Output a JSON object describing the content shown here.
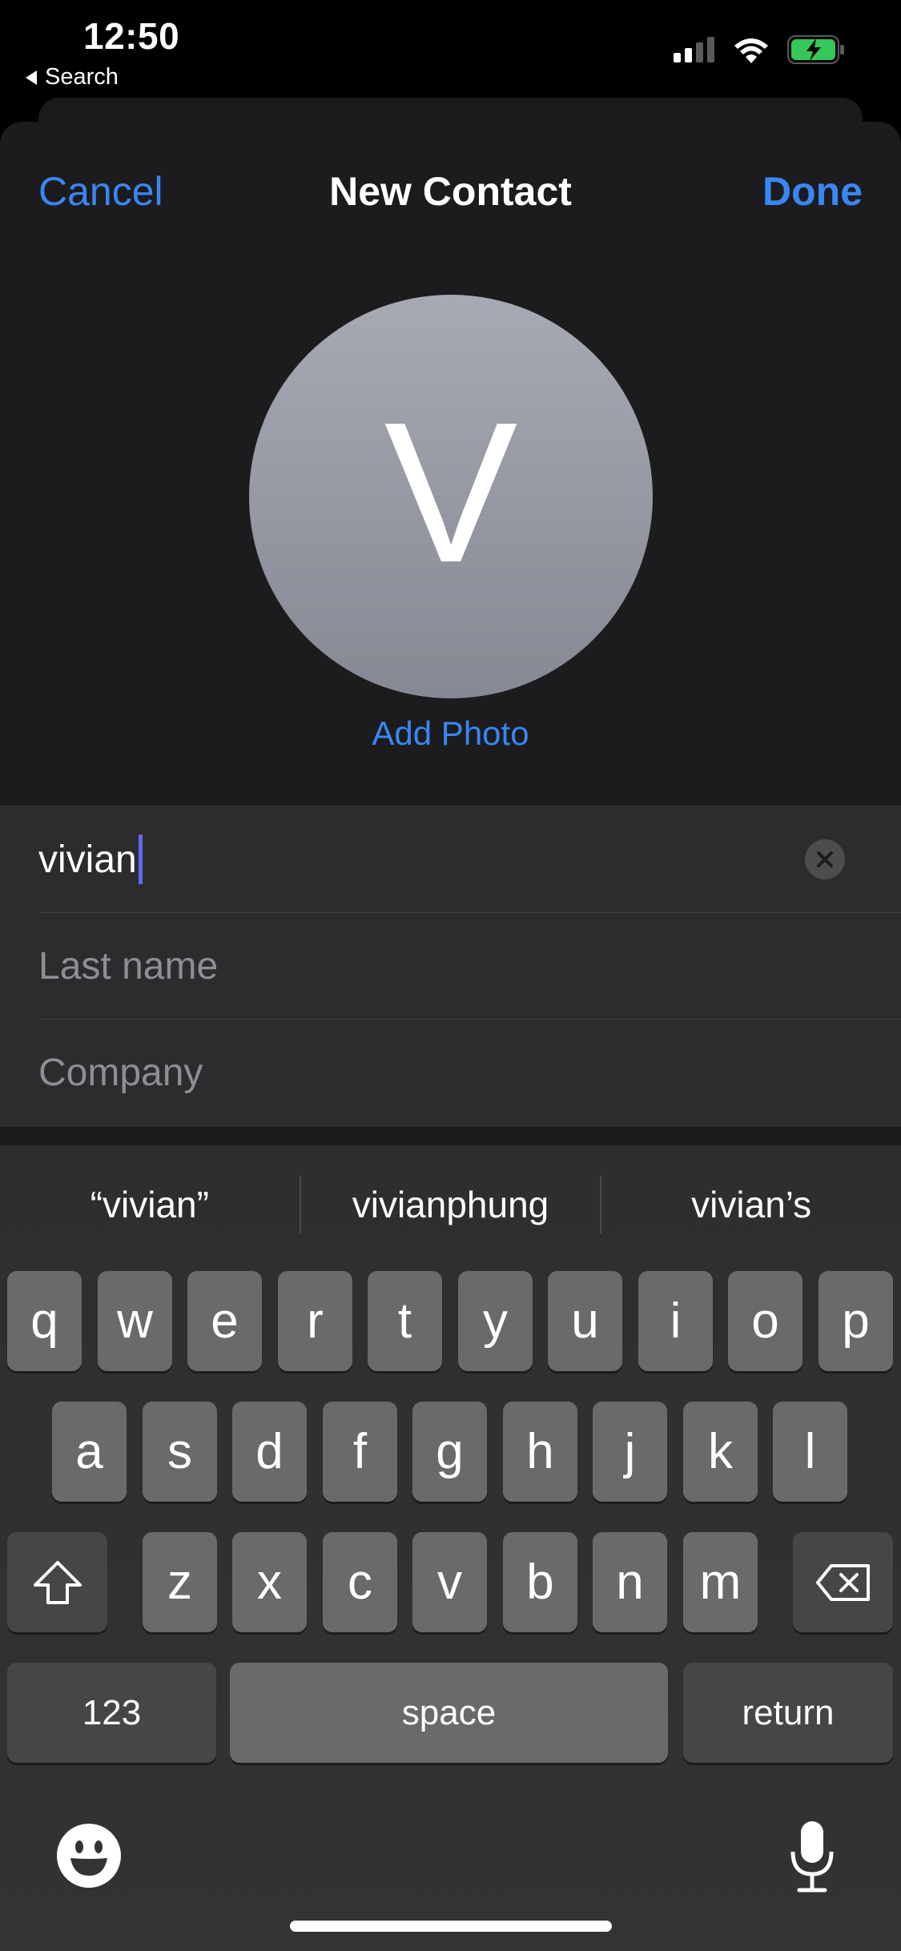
{
  "status": {
    "time": "12:50",
    "back_label": "Search"
  },
  "nav": {
    "cancel": "Cancel",
    "title": "New Contact",
    "done": "Done"
  },
  "avatar": {
    "initial": "V",
    "add_photo": "Add Photo"
  },
  "form": {
    "first_name_value": "vivian",
    "last_name_placeholder": "Last name",
    "company_placeholder": "Company"
  },
  "suggestions": [
    "“vivian”",
    "vivianphung",
    "vivian’s"
  ],
  "keyboard": {
    "row1": [
      "q",
      "w",
      "e",
      "r",
      "t",
      "y",
      "u",
      "i",
      "o",
      "p"
    ],
    "row2": [
      "a",
      "s",
      "d",
      "f",
      "g",
      "h",
      "j",
      "k",
      "l"
    ],
    "row3": [
      "z",
      "x",
      "c",
      "v",
      "b",
      "n",
      "m"
    ],
    "numbers": "123",
    "space": "space",
    "return": "return"
  },
  "colors": {
    "accent": "#3a86f4",
    "background": "#1c1c1e",
    "field": "#2c2c2e"
  }
}
